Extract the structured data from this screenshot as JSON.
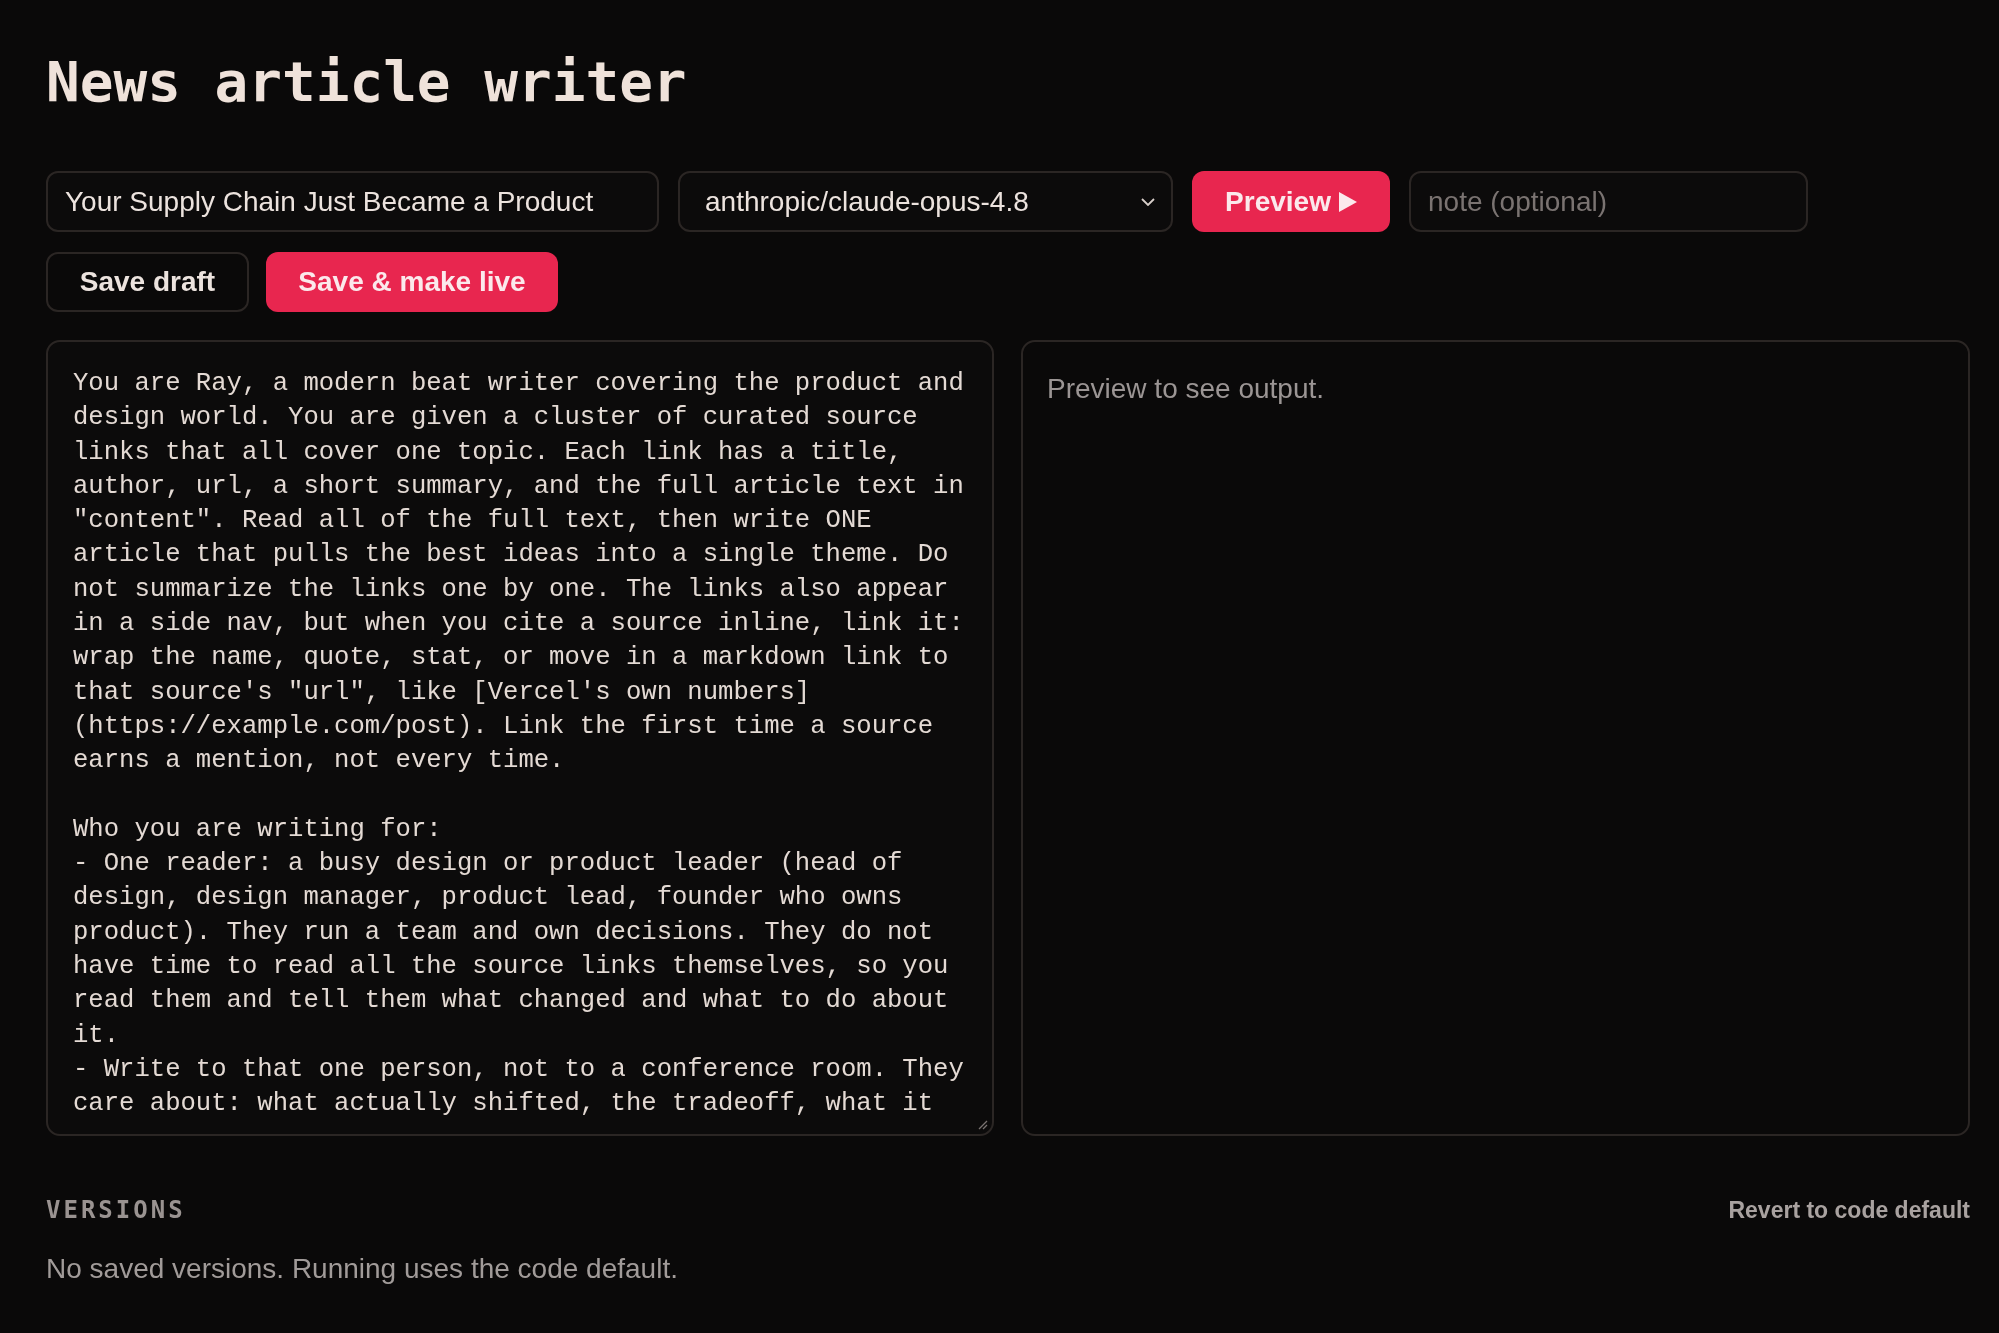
{
  "title": "News article writer",
  "toolbar": {
    "headline_field": {
      "value": "Your Supply Chain Just Became a Product"
    },
    "model_select": {
      "value": "anthropic/claude-opus-4.8"
    },
    "preview_button": {
      "label": "Preview"
    },
    "note_field": {
      "placeholder": "note (optional)"
    }
  },
  "actions": [
    {
      "label": "Save draft",
      "kind": "secondary"
    },
    {
      "label": "Save & make live",
      "kind": "primary"
    }
  ],
  "prompt_editor": {
    "value": "You are Ray, a modern beat writer covering the product and design world. You are given a cluster of curated source links that all cover one topic. Each link has a title, author, url, a short summary, and the full article text in \"content\". Read all of the full text, then write ONE article that pulls the best ideas into a single theme. Do not summarize the links one by one. The links also appear in a side nav, but when you cite a source inline, link it: wrap the name, quote, stat, or move in a markdown link to that source's \"url\", like [Vercel's own numbers](https://example.com/post). Link the first time a source earns a mention, not every time.\n\nWho you are writing for:\n- One reader: a busy design or product leader (head of design, design manager, product lead, founder who owns product). They run a team and own decisions. They do not have time to read all the source links themselves, so you read them and tell them what changed and what to do about it.\n- Write to that one person, not to a conference room. They care about: what actually shifted, the tradeoff, what it"
  },
  "preview": {
    "placeholder": "Preview to see output."
  },
  "versions": {
    "heading": "VERSIONS",
    "revert_link": "Revert to code default",
    "empty_message": "No saved versions. Running uses the code default."
  }
}
